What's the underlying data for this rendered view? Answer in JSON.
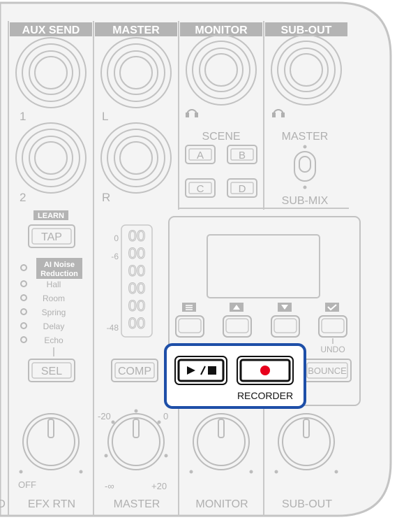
{
  "headers": {
    "aux_send": "AUX SEND",
    "master": "MASTER",
    "monitor": "MONITOR",
    "sub_out": "SUB-OUT"
  },
  "jack_labels": {
    "aux1": "1",
    "aux2": "2",
    "master_l": "L",
    "master_r": "R"
  },
  "scene": {
    "label": "SCENE",
    "a": "A",
    "b": "B",
    "c": "C",
    "d": "D"
  },
  "sub_out": {
    "master_label": "MASTER",
    "submix_label": "SUB-MIX"
  },
  "efx": {
    "learn": "LEARN",
    "tap": "TAP",
    "ai_line1": "AI Noise",
    "ai_line2": "Reduction",
    "effects": [
      "Hall",
      "Room",
      "Spring",
      "Delay",
      "Echo"
    ],
    "sel": "SEL"
  },
  "meter": {
    "ticks": [
      "0",
      "-6",
      "-48"
    ],
    "digits": [
      "00",
      "00",
      "00",
      "00",
      "00",
      "00"
    ]
  },
  "buttons": {
    "comp": "COMP",
    "bounce": "BOUNCE",
    "undo": "UNDO",
    "menu_partial": "MENU",
    "play_stop": "►/■"
  },
  "recorder": {
    "label": "RECORDER"
  },
  "knob_scales": {
    "master_min_top": "-20",
    "master_max_top": "0",
    "master_min": "-∞",
    "master_max": "+20",
    "efx_min": "OFF"
  },
  "bottom_labels": {
    "partial": "D",
    "efx_rtn": "EFX RTN",
    "master": "MASTER",
    "monitor": "MONITOR",
    "sub_out": "SUB-OUT"
  },
  "colors": {
    "highlight": "#1e4fa8",
    "record": "#e8001c",
    "panel": "#f4f4f4",
    "line": "#bdbdbd",
    "label": "#a8a8a8",
    "header_bg": "#b4b4b4"
  }
}
